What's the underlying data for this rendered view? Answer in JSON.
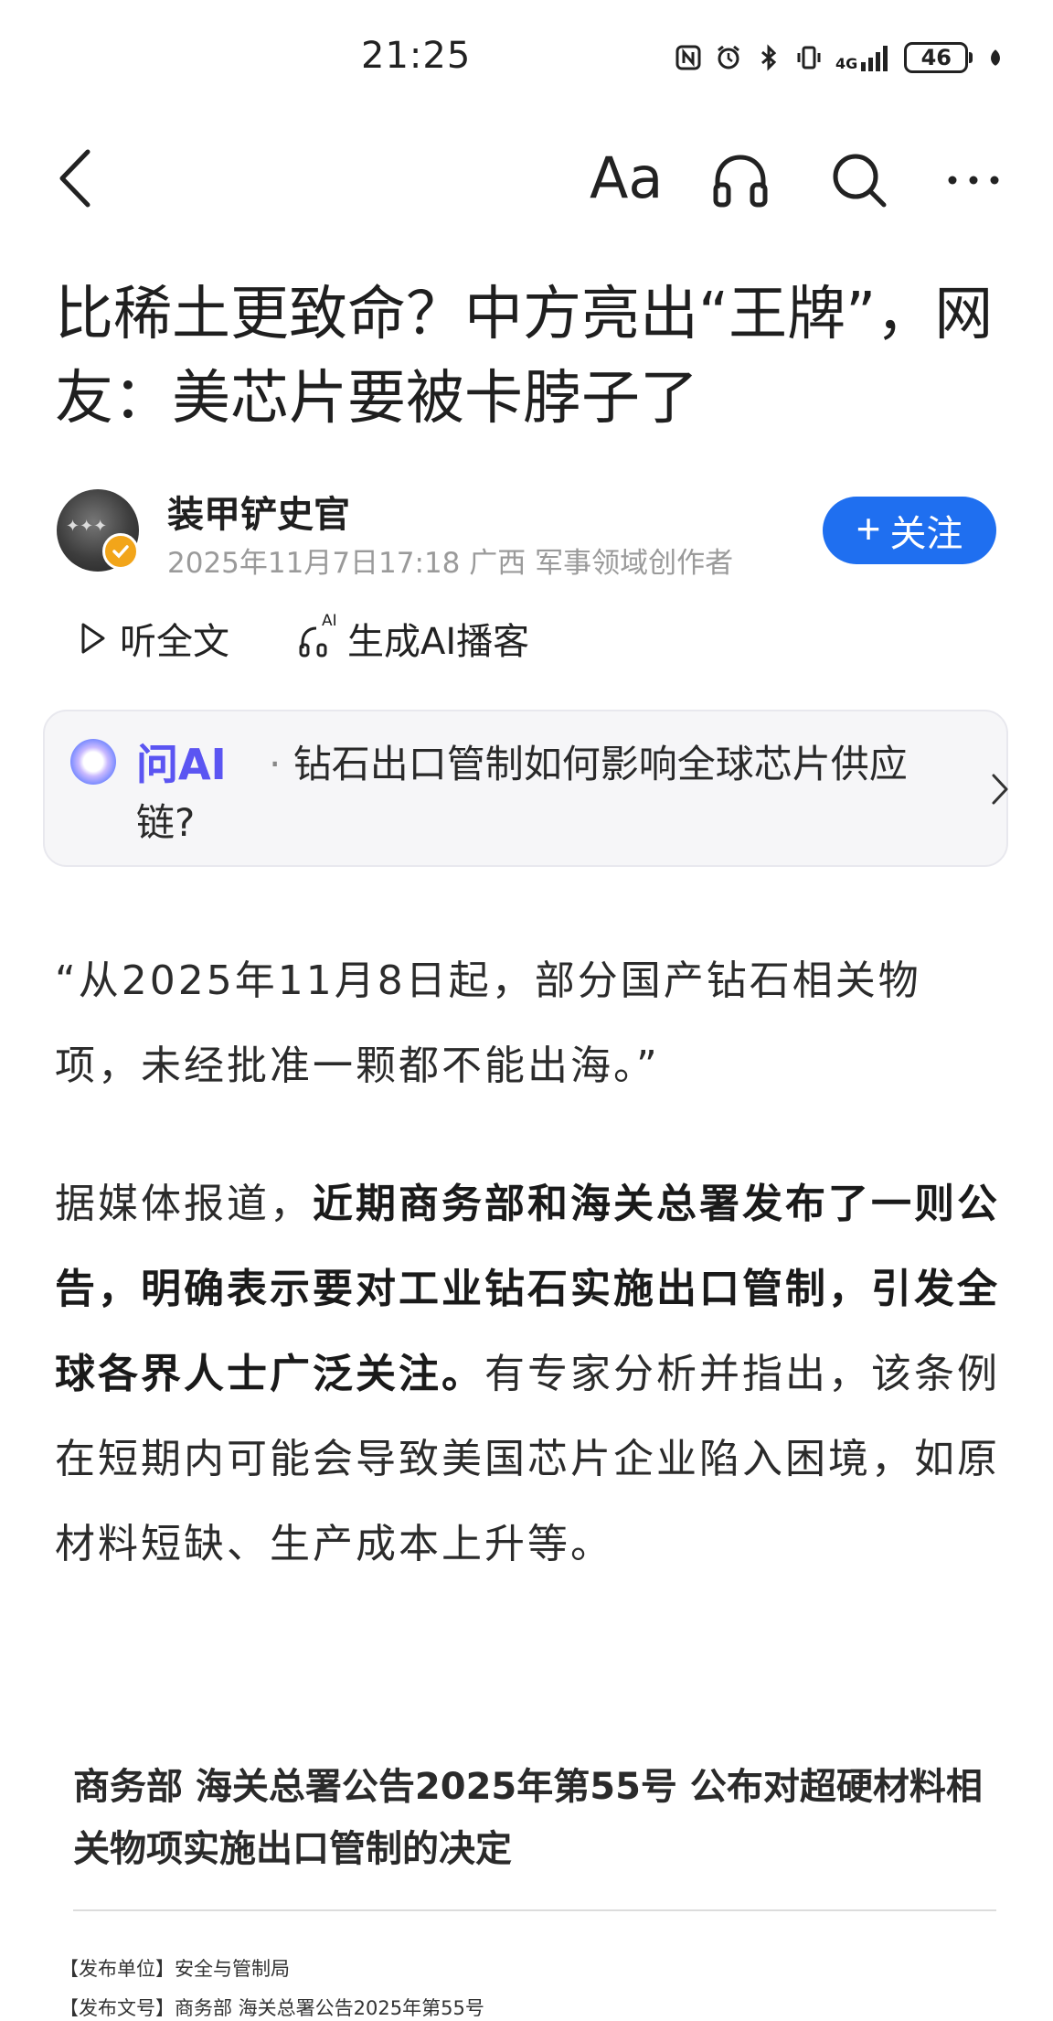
{
  "status_bar": {
    "time": "21:25",
    "network": "4G",
    "battery": "46",
    "icons": [
      "nfc-icon",
      "alarm-icon",
      "bluetooth-icon",
      "vibrate-icon",
      "signal-icon",
      "battery-icon",
      "leaf-icon"
    ]
  },
  "nav": {
    "font_size_label": "Aa",
    "icons": [
      "back-icon",
      "headphones-icon",
      "search-icon",
      "more-icon"
    ]
  },
  "article": {
    "title": "比稀土更致命？中方亮出“王牌”，网友：美芯片要被卡脖子了",
    "author": {
      "name": "装甲铲史官",
      "meta": "2025年11月7日17:18 广西 军事领域创作者",
      "follow_label": "关注",
      "follow_plus": "+"
    },
    "actions": {
      "listen_label": "听全文",
      "podcast_label": "生成AI播客",
      "podcast_badge": "AI"
    },
    "ask_ai": {
      "brand": "问AI",
      "separator": "·",
      "question": "钻石出口管制如何影响全球芯片供应链?"
    },
    "quote": "“从2025年11月8日起，部分国产钻石相关物项，未经批准一颗都不能出海。”",
    "report": {
      "lead": "据媒体报道，",
      "emphasis": "近期商务部和海关总署发布了一则公告，明确表示要对工业钻石实施出口管制，引发全球各界人士广泛关注。",
      "rest": "有专家分析并指出，该条例在短期内可能会导致美国芯片企业陷入困境，如原材料短缺、生产成本上升等。"
    },
    "embed": {
      "title": "商务部 海关总署公告2025年第55号 公布对超硬材料相关物项实施出口管制的决定",
      "line1": "【发布单位】安全与管制局",
      "line2": "【发布文号】商务部 海关总署公告2025年第55号"
    }
  },
  "colors": {
    "accent": "#1f6ff0",
    "ai_brand": "#5b55f2",
    "verify_badge": "#f2a51a",
    "meta_text": "#9a9a9a"
  }
}
